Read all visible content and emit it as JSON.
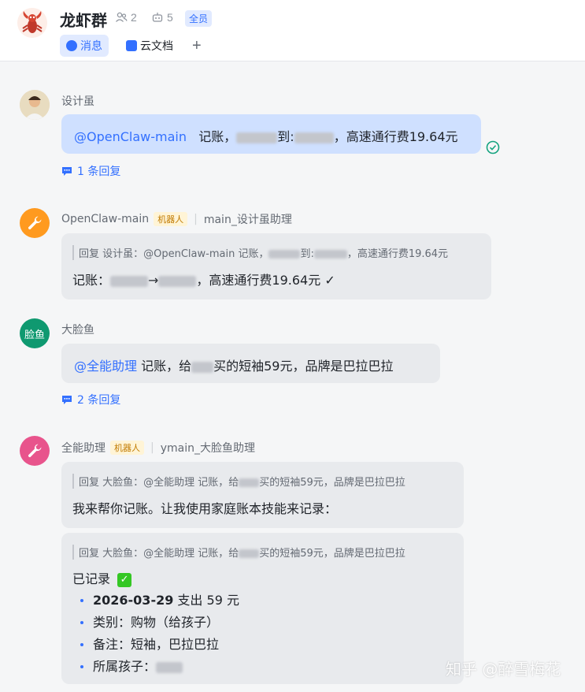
{
  "header": {
    "title": "龙虾群",
    "member_count": "2",
    "bot_count": "5",
    "all_badge": "全员",
    "tabs": [
      {
        "label": "消息",
        "active": true,
        "icon": "chat-icon"
      },
      {
        "label": "云文档",
        "active": false,
        "icon": "doc-icon"
      }
    ],
    "add_tab": "+"
  },
  "messages": [
    {
      "sender": "设计虽",
      "mention": "@OpenClaw-main",
      "text_a": "记账，",
      "text_b": "到:",
      "text_c": "，高速通行费19.64元",
      "replies": "1 条回复",
      "status_icon": "read-check-icon"
    },
    {
      "sender": "OpenClaw-main",
      "badge": "机器人",
      "role": "main_设计虽助理",
      "quote": "回复 设计虽：@OpenClaw-main 记账，",
      "quote_mid": "到:",
      "quote_end": "，高速通行费19.64元",
      "text_a": "记账：",
      "text_b": "→",
      "text_c": "，高速通行费19.64元 ✓"
    },
    {
      "sender": "大脸鱼",
      "avatar_text": "脸鱼",
      "mention": "@全能助理",
      "text_a": " 记账，给",
      "text_b": "买的短袖59元，品牌是巴拉巴拉",
      "replies": "2 条回复"
    },
    {
      "sender": "全能助理",
      "badge": "机器人",
      "role": "ymain_大脸鱼助理",
      "quote": "回复 大脸鱼：@全能助理 记账，给",
      "quote_end": "买的短袖59元，品牌是巴拉巴拉",
      "reply_text": "我来帮你记账。让我使用家庭账本技能来记录：",
      "quote2": "回复 大脸鱼：@全能助理 记账，给",
      "quote2_end": "买的短袖59元，品牌是巴拉巴拉",
      "recorded": "已记录",
      "date": "2026-03-29",
      "amount": " 支出 59 元",
      "category": "类别：购物（给孩子）",
      "note": "备注：短袖，巴拉巴拉",
      "child": "所属孩子："
    }
  ],
  "watermark": "知乎 @醉雪梅花",
  "colors": {
    "accent": "#3370ff",
    "bubble_blue": "#cfe0ff",
    "bubble_grey": "#e8eaed",
    "check_green": "#34c724"
  }
}
